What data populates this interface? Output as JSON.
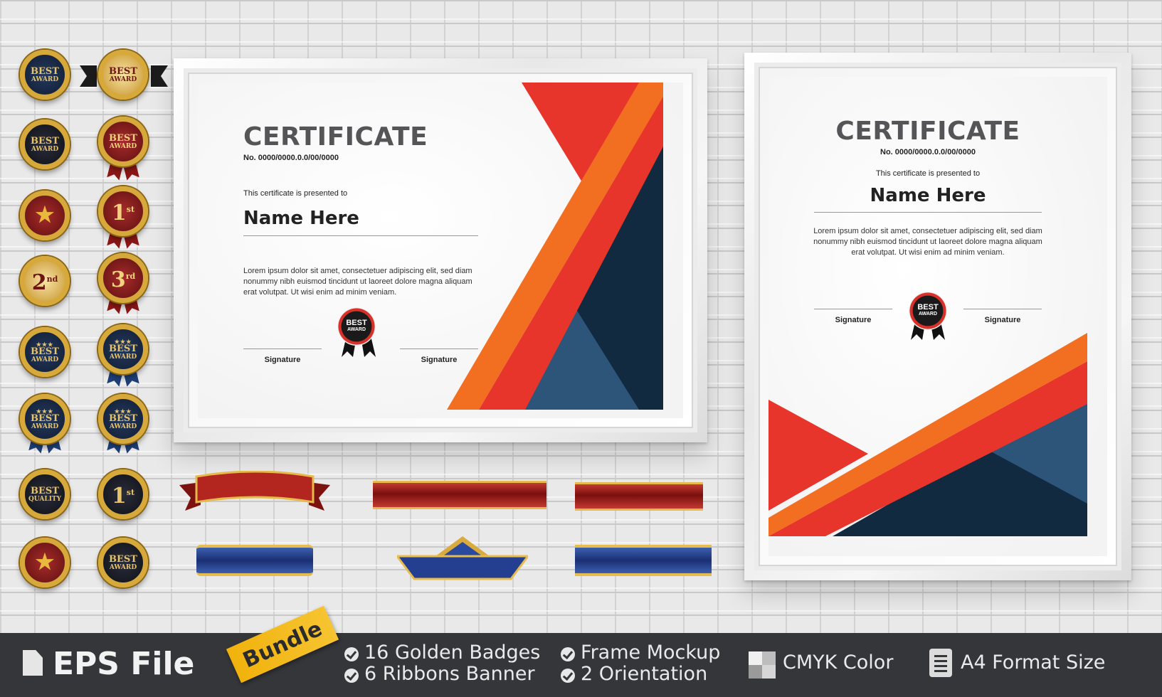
{
  "certificate_landscape": {
    "title": "CERTIFICATE",
    "number": "No. 0000/0000.0.0/00/0000",
    "presented": "This certificate is presented to",
    "name": "Name Here",
    "lorem": "Lorem ipsum dolor sit amet, consectetuer adipiscing elit, sed diam nonummy nibh euismod tincidunt ut laoreet dolore magna aliquam erat volutpat. Ut wisi enim ad minim veniam.",
    "sig_left": "Signature",
    "sig_right": "Signature",
    "seal_line1": "BEST",
    "seal_line2": "AWARD"
  },
  "certificate_portrait": {
    "title": "CERTIFICATE",
    "number": "No. 0000/0000.0.0/00/0000",
    "presented": "This certificate is presented to",
    "name": "Name Here",
    "lorem": "Lorem ipsum dolor sit amet, consectetuer adipiscing elit, sed diam nonummy nibh euismod tincidunt ut laoreet dolore magna aliquam erat volutpat. Ut wisi enim ad minim veniam.",
    "sig_left": "Signature",
    "sig_right": "Signature",
    "seal_line1": "BEST",
    "seal_line2": "AWARD"
  },
  "badges": {
    "best": "BEST",
    "award": "AWARD",
    "quality": "QUALITY",
    "first": "1",
    "first_sup": "st",
    "second": "2",
    "second_sup": "nd",
    "third": "3",
    "third_sup": "rd",
    "stars": "★★★"
  },
  "bottom_bar": {
    "eps": "EPS File",
    "bundle": "Bundle",
    "feature_1": "16 Golden Badges",
    "feature_2": "6  Ribbons Banner",
    "feature_3": "Frame Mockup",
    "feature_4": "2 Orientation",
    "cmyk": "CMYK Color",
    "a4": "A4 Format Size"
  },
  "colors": {
    "red": "#e8352b",
    "orange": "#f26f21",
    "navy": "#112a40",
    "steel_blue": "#2c5579",
    "gold": "#d6a93a",
    "bar": "#35363a"
  }
}
